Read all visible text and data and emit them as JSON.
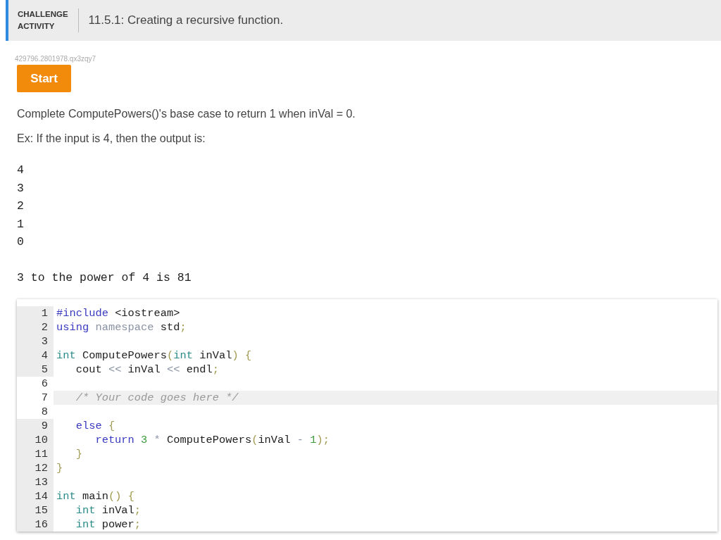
{
  "header": {
    "label_lines": [
      "CHALLENGE",
      "ACTIVITY"
    ],
    "title": "11.5.1: Creating a recursive function."
  },
  "activity_id": "429796.2801978.qx3zqy7",
  "start_button": "Start",
  "instructions": [
    "Complete ComputePowers()'s base case to return 1 when inVal = 0.",
    "Ex: If the input is 4, then the output is:"
  ],
  "output_lines": [
    "4",
    "3",
    "2",
    "1",
    "0"
  ],
  "output_result": "3 to the power of 4 is 81",
  "code_lines": [
    {
      "number": "1",
      "readonly": true,
      "active": false,
      "tokens": [
        {
          "kind": "keyword",
          "text": "#include"
        },
        {
          "kind": "plain",
          "text": " <iostream>"
        }
      ]
    },
    {
      "number": "2",
      "readonly": true,
      "active": false,
      "tokens": [
        {
          "kind": "keyword",
          "text": "using"
        },
        {
          "kind": "muted",
          "text": " namespace"
        },
        {
          "kind": "plain",
          "text": " std"
        },
        {
          "kind": "punct",
          "text": ";"
        }
      ]
    },
    {
      "number": "3",
      "readonly": true,
      "active": false
    },
    {
      "number": "4",
      "readonly": true,
      "active": false,
      "tokens": [
        {
          "kind": "type",
          "text": "int"
        },
        {
          "kind": "plain",
          "text": " ComputePowers"
        },
        {
          "kind": "punct",
          "text": "("
        },
        {
          "kind": "type",
          "text": "int"
        },
        {
          "kind": "plain",
          "text": " inVal"
        },
        {
          "kind": "punct",
          "text": ")"
        },
        {
          "kind": "punct",
          "text": " {"
        }
      ]
    },
    {
      "number": "5",
      "readonly": true,
      "active": false,
      "tokens": [
        {
          "kind": "plain",
          "text": "   cout"
        },
        {
          "kind": "muted",
          "text": " <<"
        },
        {
          "kind": "plain",
          "text": " inVal"
        },
        {
          "kind": "muted",
          "text": " <<"
        },
        {
          "kind": "plain",
          "text": " endl"
        },
        {
          "kind": "punct",
          "text": ";"
        }
      ]
    },
    {
      "number": "6",
      "readonly": false,
      "active": false
    },
    {
      "number": "7",
      "readonly": false,
      "active": true,
      "tokens": [
        {
          "kind": "comment",
          "text": "   /* Your code goes here */"
        }
      ]
    },
    {
      "number": "8",
      "readonly": false,
      "active": false
    },
    {
      "number": "9",
      "readonly": true,
      "active": false,
      "tokens": [
        {
          "kind": "keyword",
          "text": "   else"
        },
        {
          "kind": "punct",
          "text": " {"
        }
      ]
    },
    {
      "number": "10",
      "readonly": true,
      "active": false,
      "tokens": [
        {
          "kind": "keyword",
          "text": "      return"
        },
        {
          "kind": "number",
          "text": " 3"
        },
        {
          "kind": "muted",
          "text": " *"
        },
        {
          "kind": "plain",
          "text": " ComputePowers"
        },
        {
          "kind": "punct",
          "text": "("
        },
        {
          "kind": "plain",
          "text": "inVal"
        },
        {
          "kind": "muted",
          "text": " -"
        },
        {
          "kind": "number",
          "text": " 1"
        },
        {
          "kind": "punct",
          "text": ");"
        }
      ]
    },
    {
      "number": "11",
      "readonly": true,
      "active": false,
      "tokens": [
        {
          "kind": "punct",
          "text": "   }"
        }
      ]
    },
    {
      "number": "12",
      "readonly": true,
      "active": false,
      "tokens": [
        {
          "kind": "punct",
          "text": "}"
        }
      ]
    },
    {
      "number": "13",
      "readonly": true,
      "active": false
    },
    {
      "number": "14",
      "readonly": true,
      "active": false,
      "tokens": [
        {
          "kind": "type",
          "text": "int"
        },
        {
          "kind": "plain",
          "text": " main"
        },
        {
          "kind": "punct",
          "text": "()"
        },
        {
          "kind": "punct",
          "text": " {"
        }
      ]
    },
    {
      "number": "15",
      "readonly": true,
      "active": false,
      "tokens": [
        {
          "kind": "type",
          "text": "   int"
        },
        {
          "kind": "plain",
          "text": " inVal"
        },
        {
          "kind": "punct",
          "text": ";"
        }
      ]
    },
    {
      "number": "16",
      "readonly": true,
      "active": false,
      "tokens": [
        {
          "kind": "type",
          "text": "   int"
        },
        {
          "kind": "plain",
          "text": " power"
        },
        {
          "kind": "punct",
          "text": ";"
        }
      ]
    }
  ]
}
